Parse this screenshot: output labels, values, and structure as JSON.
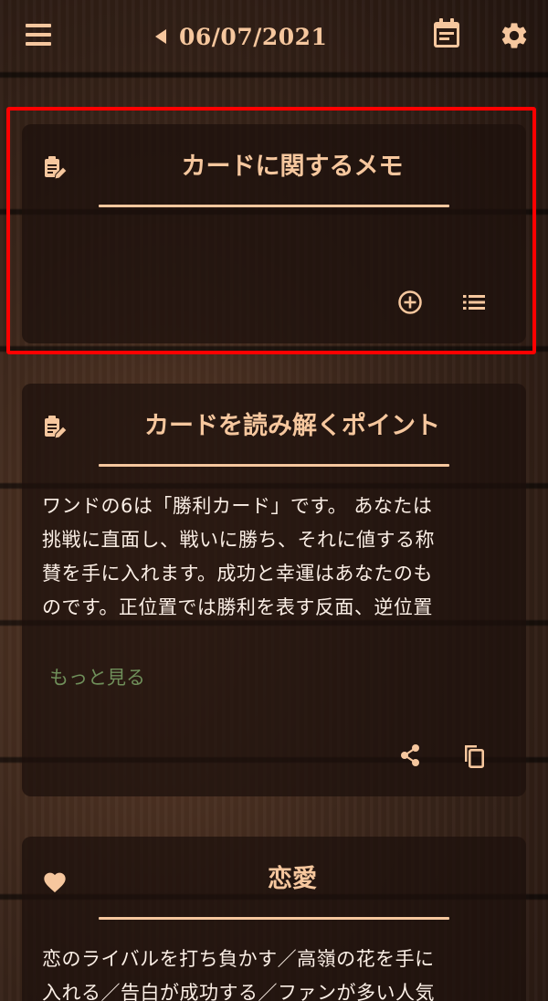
{
  "header": {
    "date": "06/07/2021",
    "icons": {
      "menu": "menu-icon",
      "prev": "chevron-left-icon",
      "calendar": "calendar-icon",
      "settings": "gear-icon"
    }
  },
  "memo_card": {
    "title": "カードに関するメモ",
    "icon": "edit-note-icon",
    "actions": [
      "add-circle-icon",
      "list-icon"
    ]
  },
  "reading_card": {
    "title": "カードを読み解くポイント",
    "icon": "edit-note-icon",
    "body_lines": [
      "ワンドの6は「勝利カード」です。 あなたは",
      "挑戦に直面し、戦いに勝ち、それに値する称",
      "賛を手に入れます。成功と幸運はあなたのも",
      "のです。正位置では勝利を表す反面、逆位置"
    ],
    "more_label": "もっと見る",
    "actions": [
      "share-icon",
      "copy-icon"
    ]
  },
  "love_card": {
    "title": "恋愛",
    "icon": "heart-icon",
    "body_lines": [
      "恋のライバルを打ち負かす／高嶺の花を手に",
      "入れる／告白が成功する／ファンが多い人気"
    ]
  },
  "colors": {
    "accent": "#f6c79e",
    "text": "#fbefe6",
    "link": "#6f8f5a",
    "highlight": "#ff0000"
  }
}
